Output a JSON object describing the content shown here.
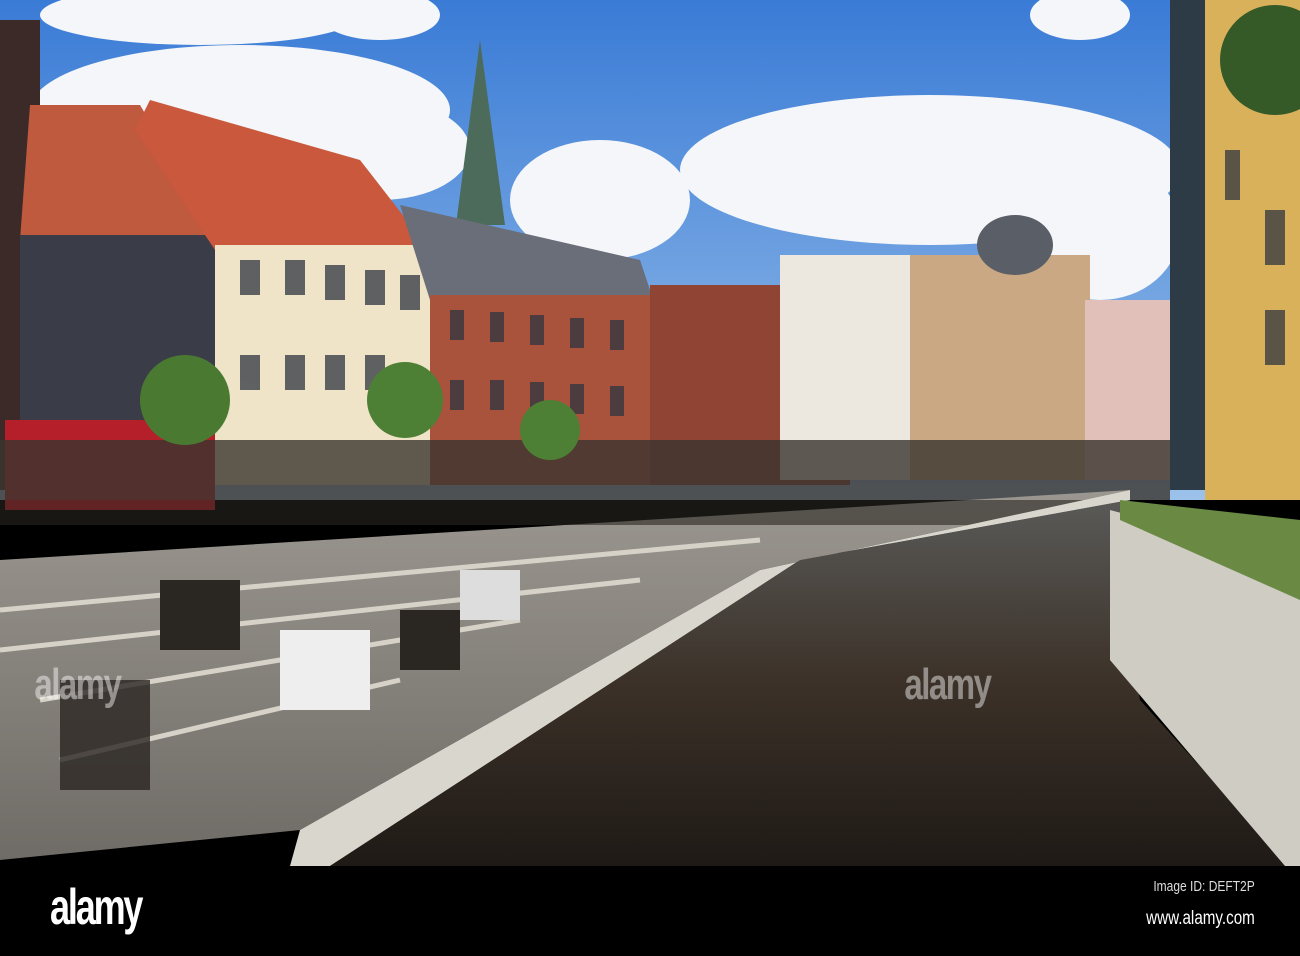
{
  "photo": {
    "subject": "canal-side street",
    "watermark": "alamy"
  },
  "footer": {
    "logo": "alamy",
    "image_id": "Image ID: DEFT2P",
    "website": "www.alamy.com"
  },
  "colors": {
    "sky": "#4a86d8",
    "brick": "#a9523c",
    "water": "#3a3028",
    "stone": "#b9b6ae"
  }
}
